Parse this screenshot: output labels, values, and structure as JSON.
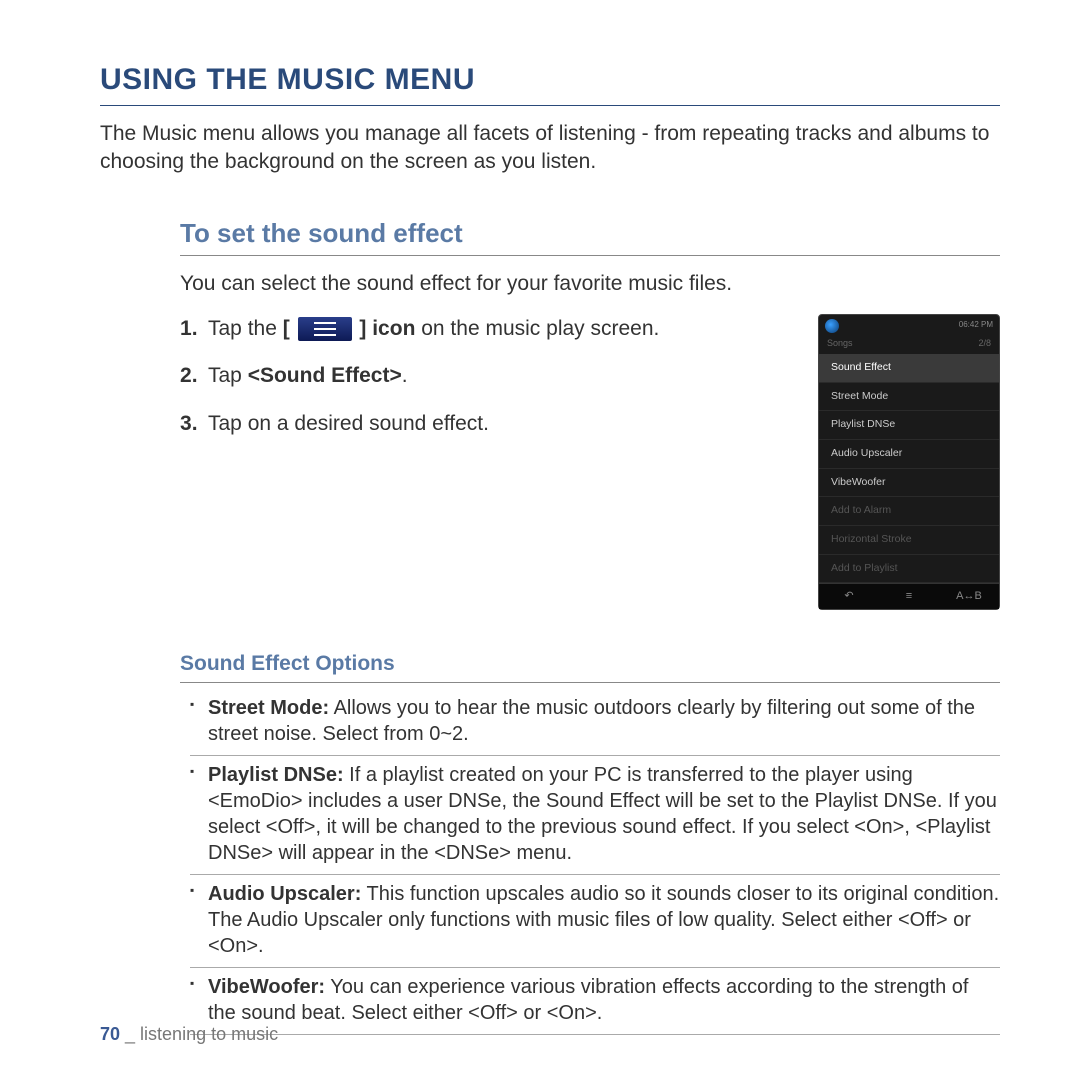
{
  "page": {
    "title": "USING THE MUSIC MENU",
    "intro": "The Music menu allows you manage all facets of listening - from repeating tracks and albums to choosing the background on the screen as you listen."
  },
  "section": {
    "title": "To set the sound effect",
    "lead": "You can select the sound effect for your favorite music files.",
    "step1_a": "Tap the ",
    "step1_b": "[ ",
    "step1_c": " ] icon",
    "step1_d": " on the music play screen.",
    "step2_a": "Tap ",
    "step2_b": "<Sound Effect>",
    "step2_c": ".",
    "step3": "Tap on a desired sound effect."
  },
  "device": {
    "time": "06:42 PM",
    "header": "Songs",
    "count": "2/8",
    "items": [
      "Sound Effect",
      "Street Mode",
      "Playlist DNSe",
      "Audio Upscaler",
      "VibeWoofer",
      "Add to Alarm",
      "Horizontal Stroke",
      "Add to Playlist"
    ],
    "bottom": {
      "back": "↶",
      "menu": "≡",
      "ab": "A↔B"
    }
  },
  "options": {
    "title": "Sound Effect Options",
    "items": [
      {
        "name": "Street Mode:",
        "desc": " Allows you to hear the music outdoors clearly by filtering out some of the street noise. Select from 0~2."
      },
      {
        "name": "Playlist DNSe:",
        "desc": " If a playlist created on your PC is transferred to the player using <EmoDio> includes a user DNSe, the Sound Effect will be set to the Playlist DNSe. If you select <Off>, it will be changed to the previous sound effect. If you select <On>, <Playlist DNSe> will appear in the <DNSe> menu."
      },
      {
        "name": "Audio Upscaler:",
        "desc": " This function upscales audio so it sounds closer to its original condition. The Audio Upscaler only functions with music files of low quality. Select either <Off> or <On>."
      },
      {
        "name": "VibeWoofer:",
        "desc": " You can experience various vibration effects according to the strength of the sound beat. Select either  <Off> or <On>."
      }
    ]
  },
  "footer": {
    "page": "70",
    "sep": " _ ",
    "chapter": "listening to music"
  }
}
